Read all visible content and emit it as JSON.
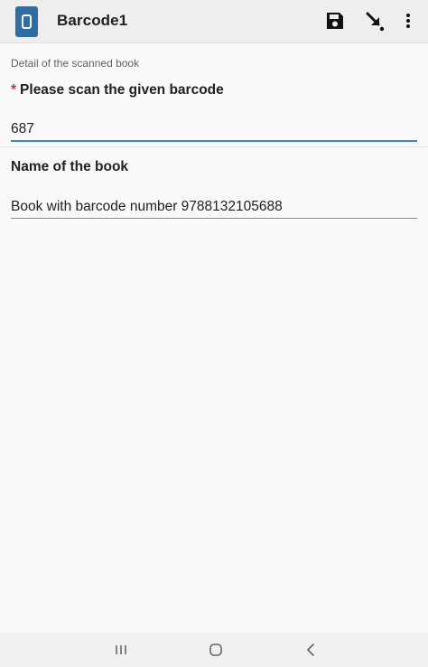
{
  "app_bar": {
    "title": "Barcode1",
    "icons": {
      "app": "app-logo-icon",
      "save": "save-icon",
      "download": "arrow-down-right-icon",
      "more": "more-vert-icon"
    }
  },
  "form": {
    "group_label": "Detail of the scanned book",
    "question1": {
      "required_marker": "*",
      "label": "Please scan the given barcode",
      "value": "687"
    },
    "question2": {
      "label": "Name of the book",
      "value": "Book with barcode number 9788132105688"
    }
  },
  "nav_bar": {
    "icons": [
      "recents-icon",
      "home-icon",
      "back-icon"
    ]
  },
  "colors": {
    "accent": "#3d86c6",
    "app_icon": "#2f6ea5",
    "required": "#d32f2f"
  }
}
